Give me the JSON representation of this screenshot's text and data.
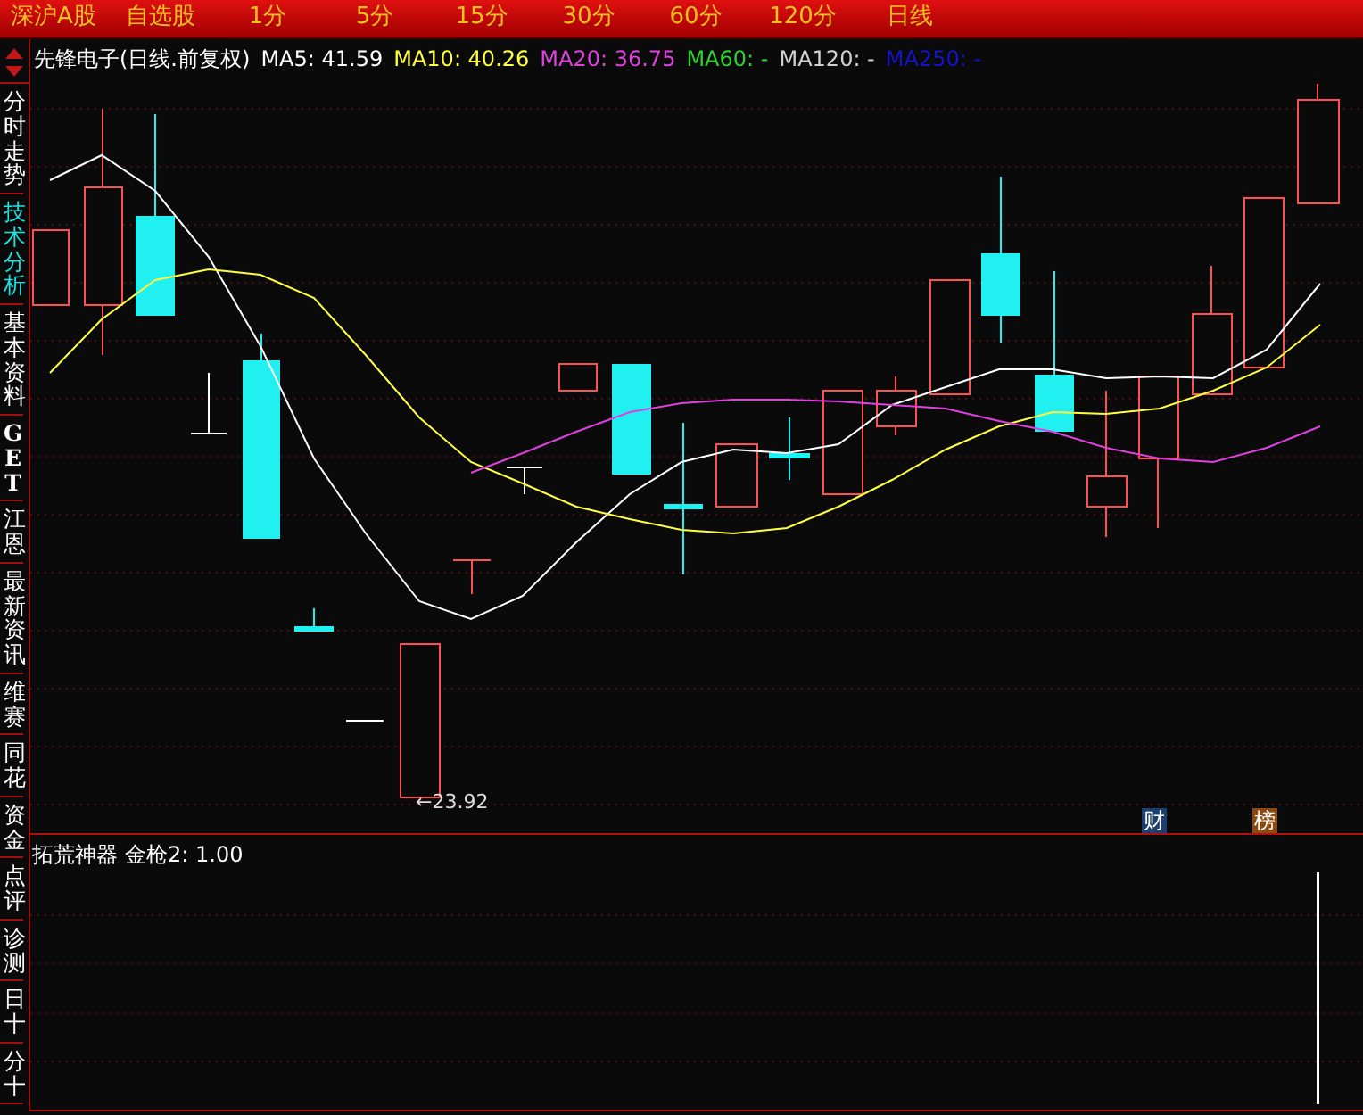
{
  "top_tabs": [
    {
      "label": "深沪A股"
    },
    {
      "label": "自选股"
    },
    {
      "label": "1分"
    },
    {
      "label": "5分"
    },
    {
      "label": "15分"
    },
    {
      "label": "30分"
    },
    {
      "label": "60分"
    },
    {
      "label": "120分"
    },
    {
      "label": "日线"
    }
  ],
  "side_tabs": [
    {
      "label": "分时走势",
      "selected": false
    },
    {
      "label": "技术分析",
      "selected": true
    },
    {
      "label": "基本资料",
      "selected": false
    },
    {
      "label": "GET",
      "selected": false
    },
    {
      "label": "江恩",
      "selected": false
    },
    {
      "label": "最新资讯",
      "selected": false
    },
    {
      "label": "维赛",
      "selected": false
    },
    {
      "label": "同花",
      "selected": false
    },
    {
      "label": "资金",
      "selected": false
    },
    {
      "label": "点评",
      "selected": false
    },
    {
      "label": "诊测",
      "selected": false
    },
    {
      "label": "日十",
      "selected": false
    },
    {
      "label": "分十",
      "selected": false
    }
  ],
  "main_chart": {
    "title": "先锋电子(日线.前复权)",
    "indicators": [
      {
        "label": "MA5: 41.59",
        "color": "#ffffff"
      },
      {
        "label": "MA10: 40.26",
        "color": "#ffff40"
      },
      {
        "label": "MA20: 36.75",
        "color": "#e040e0"
      },
      {
        "label": "MA60: -",
        "color": "#30d030"
      },
      {
        "label": "MA120: -",
        "color": "#d0d0d0"
      },
      {
        "label": "MA250: -",
        "color": "#1414c8"
      }
    ],
    "low_label": "←23.92"
  },
  "badges": [
    {
      "label": "财",
      "color": "#1c3f6e"
    },
    {
      "label": "榜",
      "color": "#8a4a10"
    }
  ],
  "lower_pane": {
    "title": "拓荒神器",
    "indicator": "金枪2: 1.00"
  }
}
